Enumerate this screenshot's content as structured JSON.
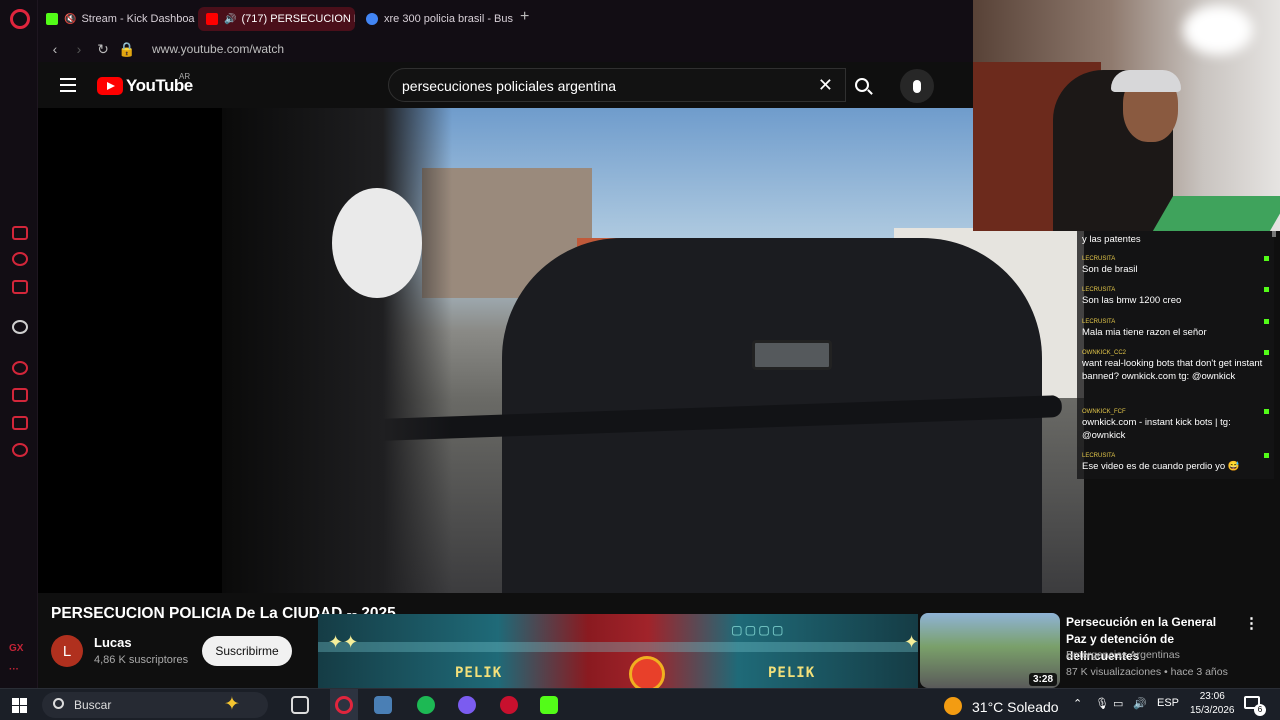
{
  "browser": {
    "sidebar_label": "GX",
    "tabs": [
      {
        "title": "Stream - Kick Dashboa",
        "favicon_color": "#53fc18"
      },
      {
        "title": "(717) PERSECUCION P",
        "favicon_color": "#ff0000"
      },
      {
        "title": "xre 300 policia brasil - Bus",
        "favicon_color": "#4285f4"
      }
    ],
    "new_tab": "+",
    "url": "www.youtube.com/watch"
  },
  "youtube": {
    "logo_text": "YouTube",
    "country": "AR",
    "search": {
      "value": "persecuciones policiales argentina"
    }
  },
  "chat": {
    "messages": [
      {
        "user": "",
        "text": "y las patentes"
      },
      {
        "user": "LECRUSITA",
        "text": "Son de brasil"
      },
      {
        "user": "LECRUSITA",
        "text": "Son las bmw 1200 creo"
      },
      {
        "user": "LECRUSITA",
        "text": "Mala mia tiene razon el señor"
      },
      {
        "user": "OWNKICK_CC2",
        "text": "want real-looking bots that don't get instant banned? ownkick.com tg: @ownkick"
      },
      {
        "user": "OWNKICK_FCF",
        "text": "ownkick.com - instant kick bots | tg: @ownkick"
      },
      {
        "user": "LECRUSITA",
        "text": "Ese video es de cuando perdio yo 😅"
      }
    ]
  },
  "video": {
    "title": "PERSECUCION POLICIA De La CIUDAD -- 2025",
    "channel": {
      "name": "Lucas",
      "avatar_letter": "L",
      "subscribers": "4,86 K suscriptores"
    },
    "subscribe_label": "Suscribirme"
  },
  "banner": {
    "left_text": "PELIK",
    "right_text": "PELIK"
  },
  "recommendation": {
    "title": "Persecución en la General Paz y detención de delincuentes",
    "channel": "Emergencias Argentinas",
    "meta": "87 K visualizaciones • hace 3 años",
    "duration": "3:28"
  },
  "taskbar": {
    "search_placeholder": "Buscar",
    "weather": "31°C  Soleado",
    "language": "ESP",
    "time": "23:06",
    "date": "15/3/2026",
    "notifications": "6"
  }
}
